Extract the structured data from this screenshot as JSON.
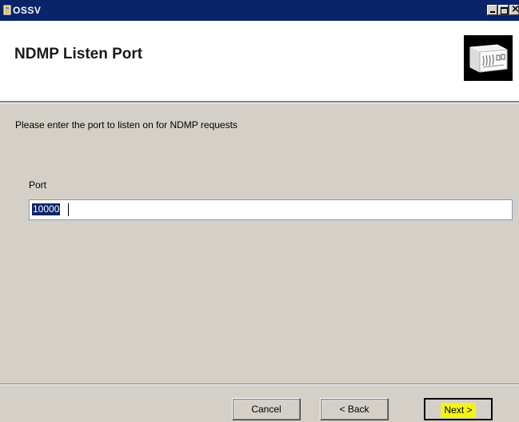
{
  "window": {
    "title": "OSSV"
  },
  "header": {
    "title": "NDMP Listen Port"
  },
  "main": {
    "instruction": "Please enter the port to listen on for NDMP requests",
    "port_label": "Port",
    "port_value": "10000"
  },
  "footer": {
    "cancel_label": "Cancel",
    "back_label": "< Back",
    "next_label": "Next >"
  },
  "colors": {
    "titlebar": "#0a246a",
    "next_highlight": "#f3f318"
  }
}
